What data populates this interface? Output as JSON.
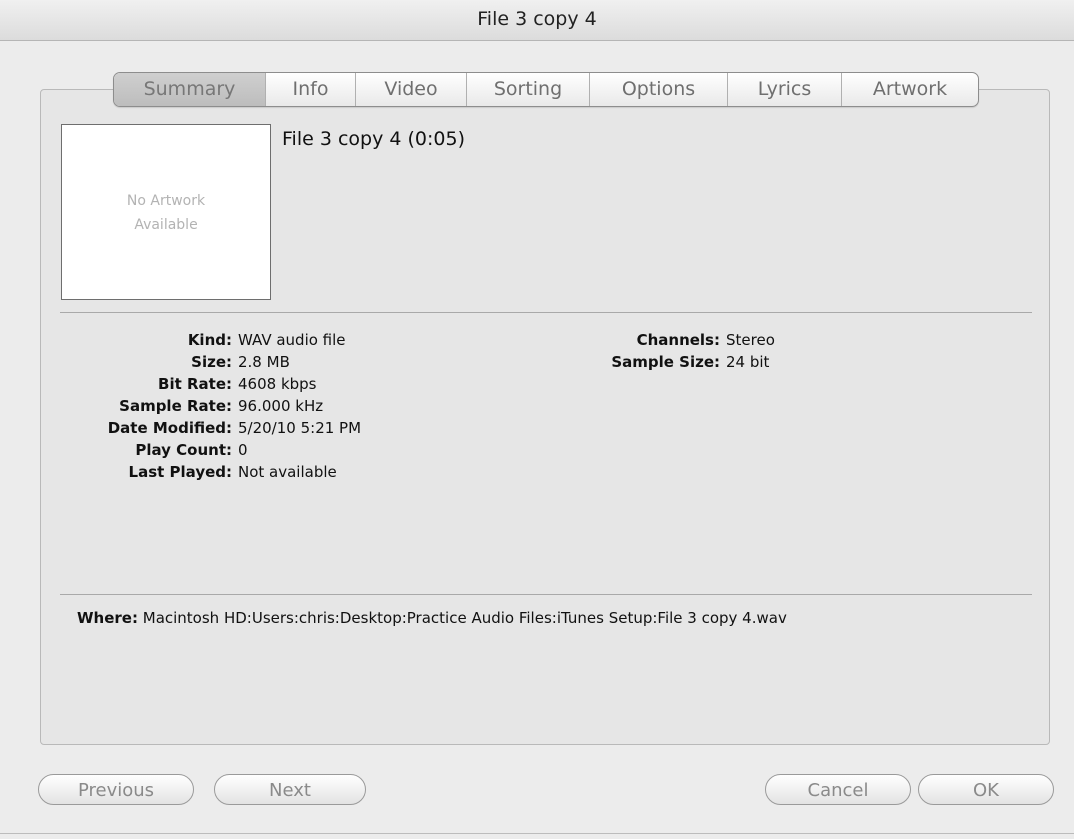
{
  "window": {
    "title": "File 3 copy 4"
  },
  "tabs": [
    {
      "label": "Summary",
      "active": true
    },
    {
      "label": "Info",
      "active": false
    },
    {
      "label": "Video",
      "active": false
    },
    {
      "label": "Sorting",
      "active": false
    },
    {
      "label": "Options",
      "active": false
    },
    {
      "label": "Lyrics",
      "active": false
    },
    {
      "label": "Artwork",
      "active": false
    }
  ],
  "artwork": {
    "placeholder": "No Artwork\nAvailable"
  },
  "track": {
    "title": "File 3 copy 4 (0:05)"
  },
  "details_left": [
    {
      "label": "Kind:",
      "value": "WAV audio file"
    },
    {
      "label": "Size:",
      "value": "2.8 MB"
    },
    {
      "label": "Bit Rate:",
      "value": "4608 kbps"
    },
    {
      "label": "Sample Rate:",
      "value": "96.000 kHz"
    },
    {
      "label": "Date Modified:",
      "value": "5/20/10 5:21 PM"
    },
    {
      "label": "Play Count:",
      "value": "0"
    },
    {
      "label": "Last Played:",
      "value": "Not available"
    }
  ],
  "details_right": [
    {
      "label": "Channels:",
      "value": "Stereo"
    },
    {
      "label": "Sample Size:",
      "value": "24 bit"
    }
  ],
  "where": {
    "label": "Where:",
    "value": "Macintosh HD:Users:chris:Desktop:Practice Audio Files:iTunes Setup:File 3 copy 4.wav"
  },
  "buttons": {
    "previous": "Previous",
    "next": "Next",
    "cancel": "Cancel",
    "ok": "OK"
  }
}
